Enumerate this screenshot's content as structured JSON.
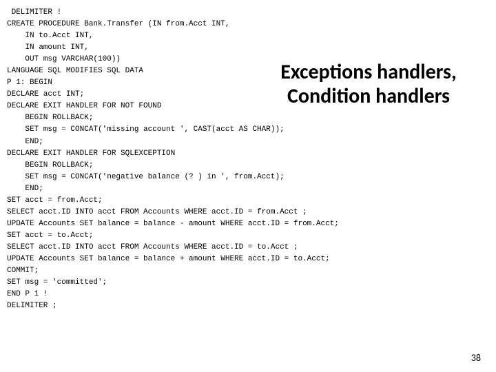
{
  "title": "Exceptions handlers, Condition handlers",
  "page_number": "38",
  "code_lines": [
    " DELIMITER !",
    "CREATE PROCEDURE Bank.Transfer (IN from.Acct INT,",
    "    IN to.Acct INT,",
    "    IN amount INT,",
    "    OUT msg VARCHAR(100))",
    "LANGUAGE SQL MODIFIES SQL DATA",
    "P 1: BEGIN",
    "DECLARE acct INT;",
    "DECLARE EXIT HANDLER FOR NOT FOUND",
    "    BEGIN ROLLBACK;",
    "    SET msg = CONCAT('missing account ', CAST(acct AS CHAR));",
    "    END;",
    "DECLARE EXIT HANDLER FOR SQLEXCEPTION",
    "    BEGIN ROLLBACK;",
    "    SET msg = CONCAT('negative balance (? ) in ', from.Acct);",
    "    END;",
    "SET acct = from.Acct;",
    "SELECT acct.ID INTO acct FROM Accounts WHERE acct.ID = from.Acct ;",
    "UPDATE Accounts SET balance = balance - amount WHERE acct.ID = from.Acct;",
    "SET acct = to.Acct;",
    "SELECT acct.ID INTO acct FROM Accounts WHERE acct.ID = to.Acct ;",
    "UPDATE Accounts SET balance = balance + amount WHERE acct.ID = to.Acct;",
    "COMMIT;",
    "SET msg = 'committed';",
    "END P 1 !",
    "DELIMITER ;"
  ]
}
